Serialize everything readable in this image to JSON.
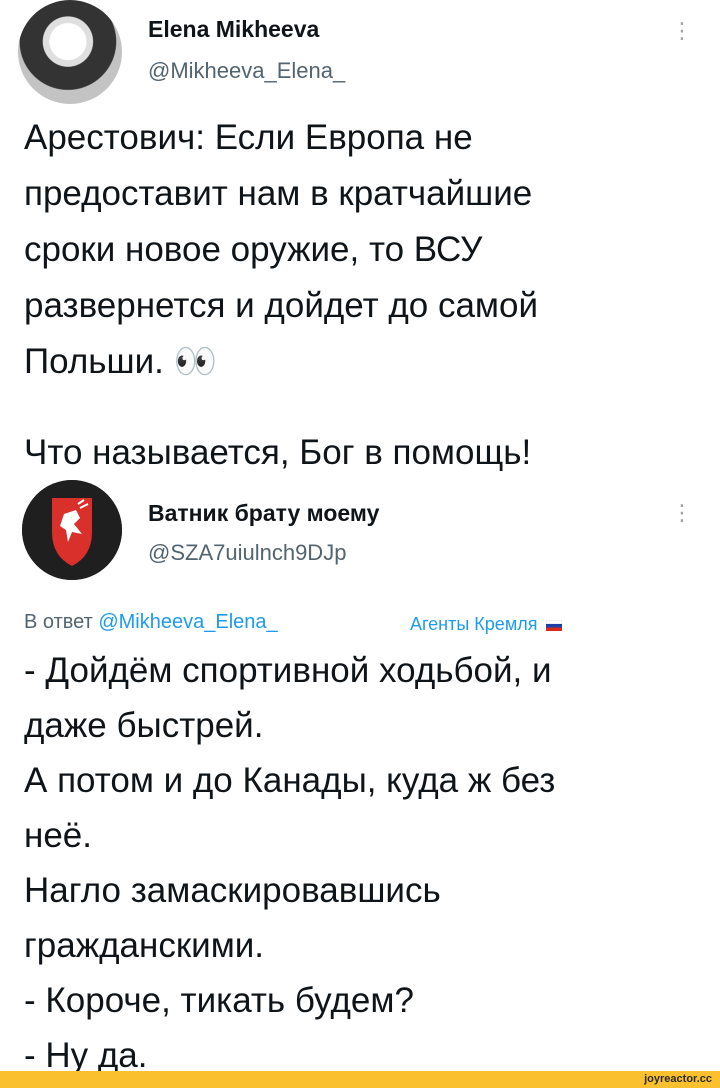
{
  "tweet": {
    "author_name": "Elena Mikheeva",
    "author_handle": "@Mikheeva_Elena_",
    "text_lines": [
      "Арестович: Если Европа не",
      "предоставит нам в кратчайшие",
      "сроки новое оружие, то ВСУ",
      "развернется и дойдет до самой",
      "Польши. 👀"
    ],
    "text_last": "Что называется, Бог в помощь!",
    "menu_glyph": "⋮"
  },
  "reply": {
    "author_name": "Ватник брату моему",
    "author_handle": "@SZA7uiulnch9DJp",
    "reply_prefix": "В ответ",
    "reply_mention": "@Mikheeva_Elena_",
    "label_tag": "Агенты Кремля",
    "flag_icon": "russia-flag-icon",
    "menu_glyph": "⋮",
    "text_lines": [
      "- Дойдём спортивной ходьбой, и",
      "даже быстрей.",
      "А потом и до Канады, куда ж без",
      "неё.",
      "Нагло замаскировавшись",
      "гражданскими.",
      "- Короче, тикать будем?",
      "- Ну да."
    ]
  },
  "watermark": "joyreactor.cc",
  "colors": {
    "text": "#0f1419",
    "muted": "#536471",
    "link": "#1d9bf0",
    "footer": "#fbc02d"
  }
}
